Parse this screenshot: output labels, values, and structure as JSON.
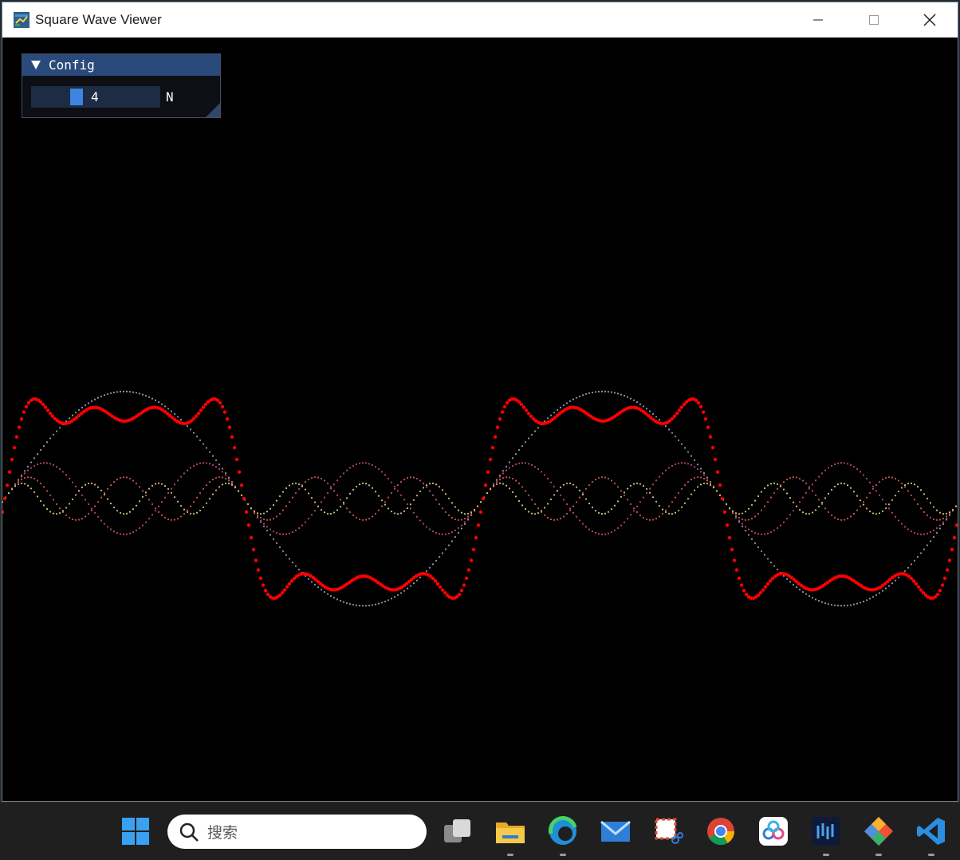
{
  "window": {
    "title": "Square Wave Viewer",
    "icon": "python-app-icon"
  },
  "config_panel": {
    "header": "Config",
    "slider_value": "4",
    "slider_label": "N"
  },
  "chart_data": {
    "type": "line",
    "description_terms": "Fourier square wave partial sum with first N odd harmonics",
    "n_terms": 4,
    "harmonics": [
      1,
      3,
      5,
      7
    ],
    "amplitudes": [
      1.0,
      0.3333,
      0.2,
      0.1429
    ],
    "periods_shown": 2,
    "series": [
      {
        "harmonic": 1,
        "color": "#8b9aa8"
      },
      {
        "harmonic": 3,
        "color": "#b8456f"
      },
      {
        "harmonic": 5,
        "color": "#c75555"
      },
      {
        "harmonic": 7,
        "color": "#c8c27a"
      },
      {
        "harmonic": "sum",
        "color": "#ff0000"
      }
    ]
  },
  "taskbar": {
    "search_placeholder": "搜索",
    "apps": [
      "windows-start-icon",
      "task-view-icon",
      "file-explorer-icon",
      "edge-icon",
      "mail-icon",
      "snipping-tool-icon",
      "chrome-icon",
      "baidu-netdisk-icon",
      "terminal-app-icon",
      "git-icon",
      "vscode-icon"
    ]
  }
}
